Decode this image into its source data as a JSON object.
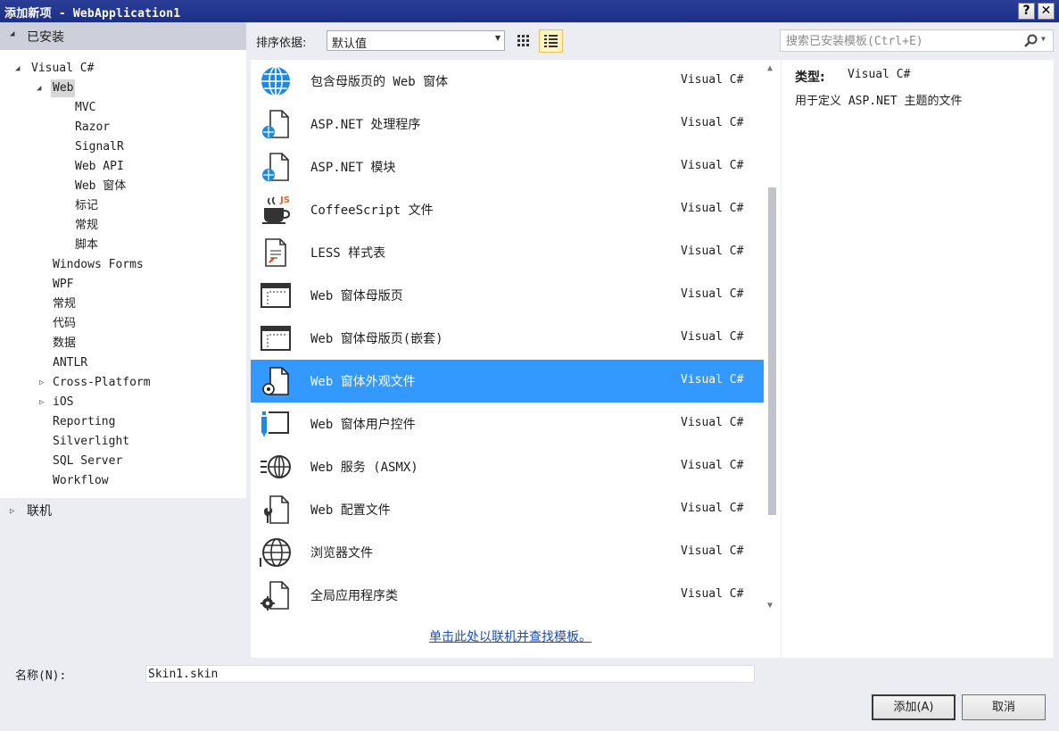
{
  "window": {
    "title": "添加新项 - WebApplication1",
    "help_label": "?",
    "close_label": "✕"
  },
  "left": {
    "installed_label": "已安装",
    "tree": [
      "Visual C#",
      "Web",
      "MVC",
      "Razor",
      "SignalR",
      "Web API",
      "Web 窗体",
      "标记",
      "常规",
      "脚本",
      "Windows Forms",
      "WPF",
      "常规",
      "代码",
      "数据",
      "ANTLR",
      "Cross-Platform",
      "iOS",
      "Reporting",
      "Silverlight",
      "SQL Server",
      "Workflow"
    ],
    "online_label": "联机"
  },
  "toolbar": {
    "sort_label": "排序依据:",
    "sort_value": "默认值",
    "search_placeholder": "搜索已安装模板(Ctrl+E)"
  },
  "templates": [
    {
      "name": "包含母版页的 Web 窗体",
      "lang": "Visual C#",
      "icon": "globe-icon"
    },
    {
      "name": "ASP.NET 处理程序",
      "lang": "Visual C#",
      "icon": "handler-file-icon"
    },
    {
      "name": "ASP.NET 模块",
      "lang": "Visual C#",
      "icon": "module-file-icon"
    },
    {
      "name": "CoffeeScript 文件",
      "lang": "Visual C#",
      "icon": "coffee-cup-icon"
    },
    {
      "name": "LESS 样式表",
      "lang": "Visual C#",
      "icon": "stylesheet-icon"
    },
    {
      "name": "Web 窗体母版页",
      "lang": "Visual C#",
      "icon": "master-page-icon"
    },
    {
      "name": "Web 窗体母版页(嵌套)",
      "lang": "Visual C#",
      "icon": "nested-master-page-icon"
    },
    {
      "name": "Web 窗体外观文件",
      "lang": "Visual C#",
      "icon": "skin-file-icon",
      "selected": true
    },
    {
      "name": "Web 窗体用户控件",
      "lang": "Visual C#",
      "icon": "user-control-icon"
    },
    {
      "name": "Web 服务 (ASMX)",
      "lang": "Visual C#",
      "icon": "web-service-icon"
    },
    {
      "name": "Web 配置文件",
      "lang": "Visual C#",
      "icon": "config-file-icon"
    },
    {
      "name": "浏览器文件",
      "lang": "Visual C#",
      "icon": "browser-file-icon"
    },
    {
      "name": "全局应用程序类",
      "lang": "Visual C#",
      "icon": "global-class-icon"
    }
  ],
  "online_link": "单击此处以联机并查找模板。",
  "details": {
    "type_label": "类型:",
    "type_value": "Visual C#",
    "description": "用于定义 ASP.NET 主题的文件"
  },
  "bottom": {
    "name_label": "名称(N):",
    "name_value": "Skin1.skin",
    "add_label": "添加(A)",
    "cancel_label": "取消"
  },
  "colors": {
    "selection": "#3399ff",
    "titlebar": "#2b3e98",
    "link": "#1c4dbb"
  }
}
